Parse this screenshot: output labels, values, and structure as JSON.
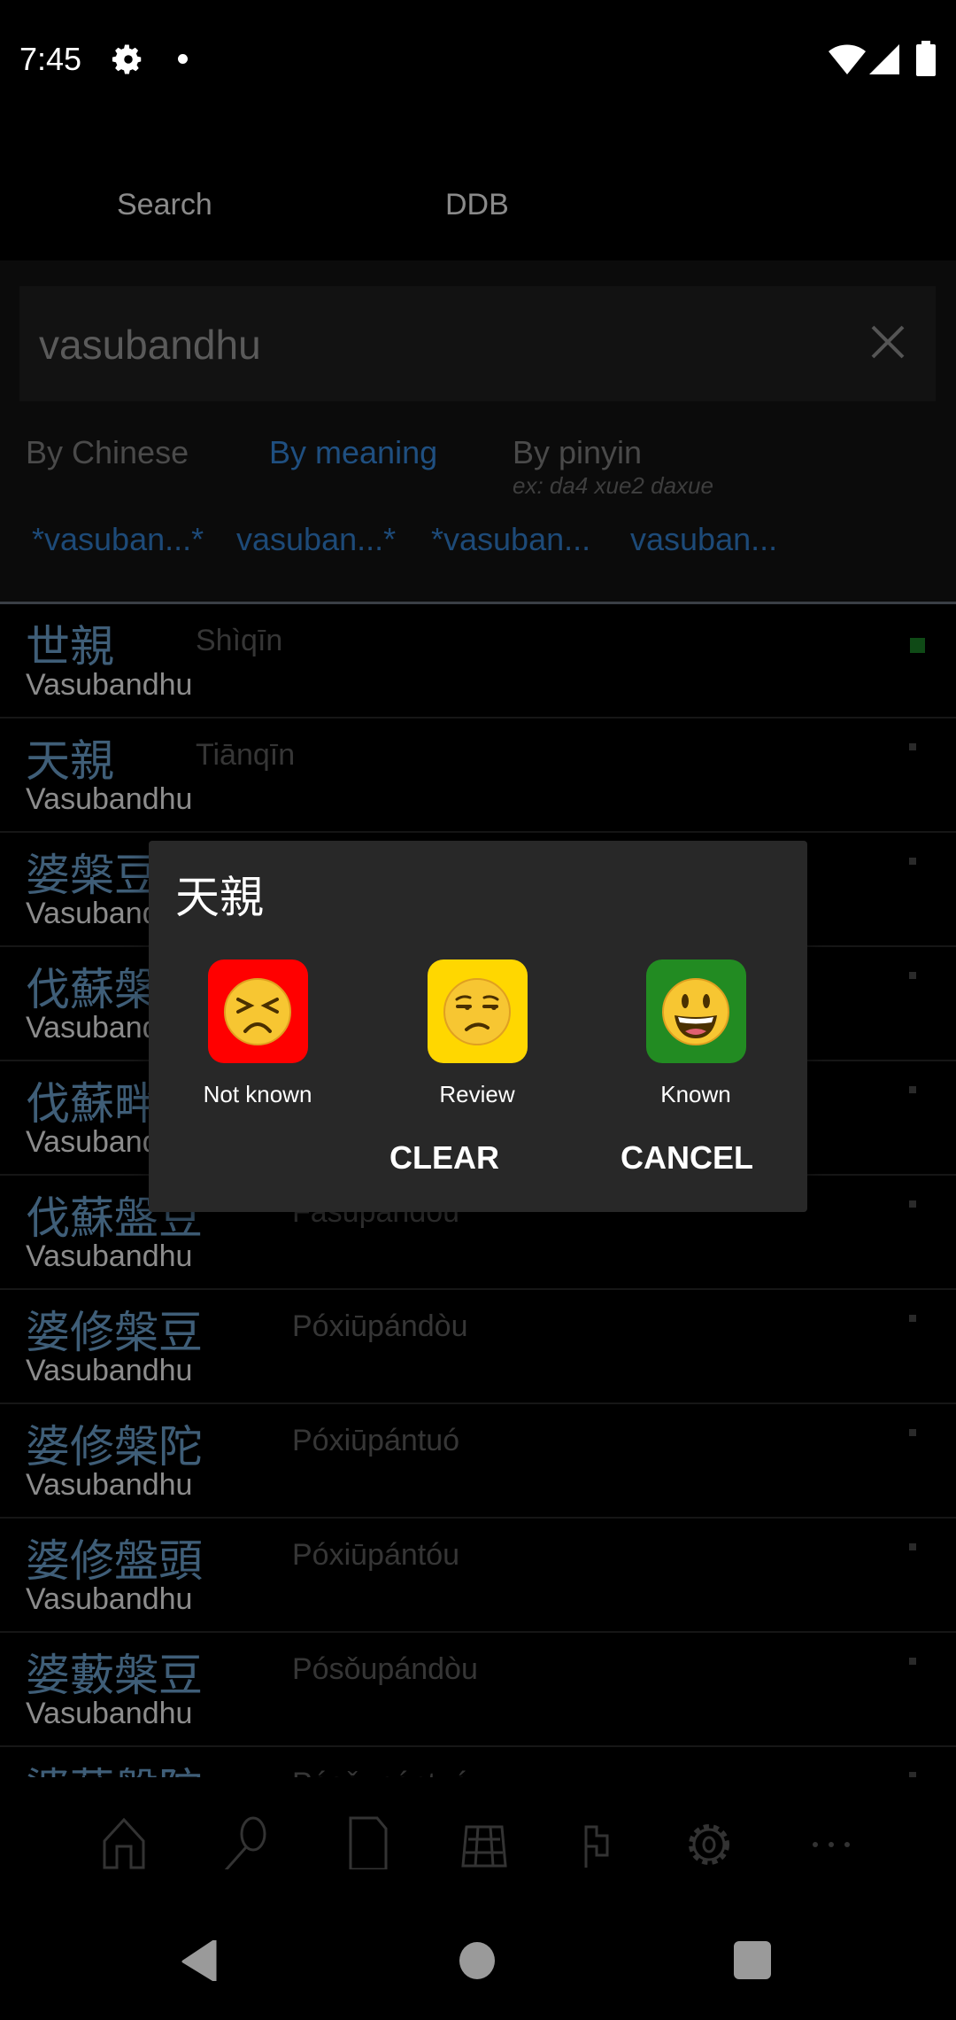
{
  "status_bar": {
    "time": "7:45",
    "icons": [
      "gear-icon",
      "dot-icon",
      "wifi-icon",
      "signal-icon",
      "battery-icon"
    ]
  },
  "tabs": [
    {
      "label": "Search"
    },
    {
      "label": "DDB"
    }
  ],
  "search": {
    "value": "vasubandhu",
    "clear_icon": "close-icon"
  },
  "filters": {
    "by_chinese": "By Chinese",
    "by_meaning": "By meaning",
    "by_pinyin": "By pinyin",
    "pinyin_hint": "ex: da4 xue2 daxue",
    "active": "By meaning"
  },
  "suggestions": [
    "*vasuban...*",
    "vasuban...*",
    "*vasuban...",
    "vasuban..."
  ],
  "results": [
    {
      "chinese": "世親",
      "pinyin": "Shìqīn",
      "meaning": "Vasubandhu",
      "status": "known"
    },
    {
      "chinese": "天親",
      "pinyin": "Tiānqīn",
      "meaning": "Vasubandhu",
      "status": "none"
    },
    {
      "chinese": "婆槃豆",
      "pinyin": "",
      "meaning": "Vasubandhu",
      "status": "none"
    },
    {
      "chinese": "伐蘇槃",
      "pinyin": "",
      "meaning": "Vasubandhu",
      "status": "none"
    },
    {
      "chinese": "伐蘇畔",
      "pinyin": "",
      "meaning": "Vasubandhu",
      "status": "none"
    },
    {
      "chinese": "伐蘇盤豆",
      "pinyin": "Fásūpándòu",
      "meaning": "Vasubandhu",
      "status": "none"
    },
    {
      "chinese": "婆修槃豆",
      "pinyin": "Póxiūpándòu",
      "meaning": "Vasubandhu",
      "status": "none"
    },
    {
      "chinese": "婆修槃陀",
      "pinyin": "Póxiūpántuó",
      "meaning": "Vasubandhu",
      "status": "none"
    },
    {
      "chinese": "婆修盤頭",
      "pinyin": "Póxiūpántóu",
      "meaning": "Vasubandhu",
      "status": "none"
    },
    {
      "chinese": "婆藪槃豆",
      "pinyin": "Pósǒupándòu",
      "meaning": "Vasubandhu",
      "status": "none"
    },
    {
      "chinese": "婆藪盤陀",
      "pinyin": "Pósǒupántuó",
      "meaning": "",
      "status": "none"
    }
  ],
  "bottom_nav": [
    "home-icon",
    "search-icon",
    "document-icon",
    "grid-icon",
    "flag-icon",
    "settings-icon",
    "more-icon"
  ],
  "dialog": {
    "title": "天親",
    "options": [
      {
        "label": "Not known",
        "color": "#ff0000",
        "icon": "persevering-face-icon"
      },
      {
        "label": "Review",
        "color": "#ffd700",
        "icon": "unamused-face-icon"
      },
      {
        "label": "Known",
        "color": "#228b22",
        "icon": "smiling-face-icon"
      }
    ],
    "clear_label": "CLEAR",
    "cancel_label": "CANCEL"
  },
  "colors": {
    "accent": "#1f4f80",
    "chinese_text": "#3f5e78",
    "known": "#0f4a16"
  }
}
